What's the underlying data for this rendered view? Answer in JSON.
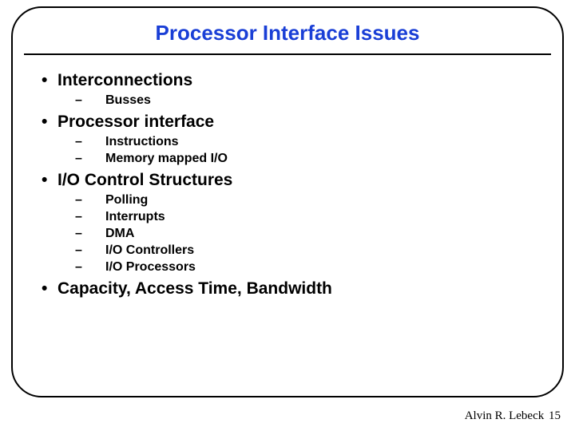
{
  "title": "Processor Interface Issues",
  "bullets": {
    "b0": "Interconnections",
    "b0s": {
      "s0": "Busses"
    },
    "b1": "Processor interface",
    "b1s": {
      "s0": "Instructions",
      "s1": "Memory mapped I/O"
    },
    "b2": "I/O Control Structures",
    "b2s": {
      "s0": "Polling",
      "s1": "Interrupts",
      "s2": "DMA",
      "s3": "I/O Controllers",
      "s4": "I/O Processors"
    },
    "b3": "Capacity, Access Time, Bandwidth"
  },
  "footer": {
    "author": "Alvin R. Lebeck",
    "page": "15"
  }
}
